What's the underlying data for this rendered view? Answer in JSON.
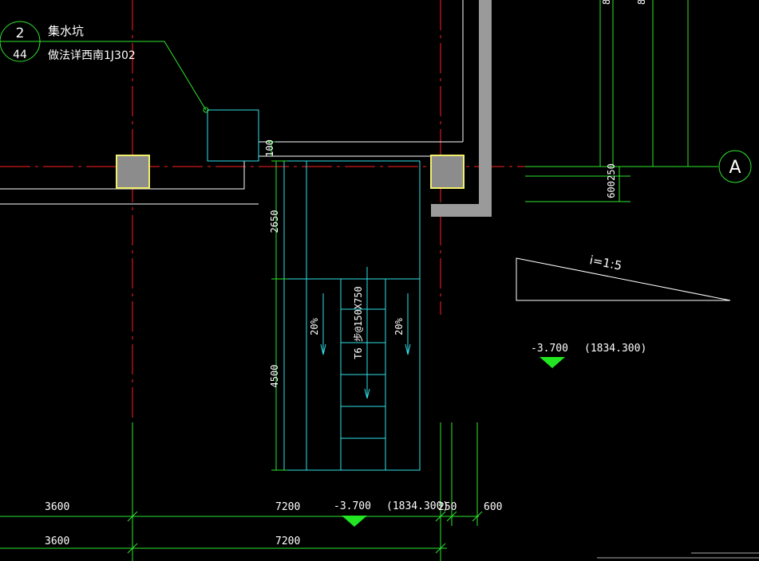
{
  "colors": {
    "background": "#000000",
    "axis": "#ff2020",
    "dimension": "#2ee62e",
    "wall": "#ffffff",
    "pit": "#2fdfe6",
    "column_fill": "#8c8c8c",
    "column_edge": "#f2f06a",
    "slab": "#9a9a9a",
    "text": "#ffffff",
    "level_marker": "#22e622"
  },
  "callout": {
    "ref_number": "2",
    "sheet_number": "44",
    "title": "集水坑",
    "note": "做法详西南1J302"
  },
  "axis_bubble": {
    "label": "A"
  },
  "dims": {
    "pit_gap": "100",
    "right_250": "250",
    "right_600": "600",
    "ramp_2650": "2650",
    "ramp_4500": "4500",
    "bottom_row1": [
      "3600",
      "7200",
      "250",
      "600"
    ],
    "bottom_row2": [
      "3600",
      "7200"
    ]
  },
  "ramp": {
    "left_slope": "20%",
    "right_slope": "20%",
    "steps_note": "Τ6 步@150X750"
  },
  "slope_note": "i=1:5",
  "levels": [
    {
      "value": "-3.700",
      "absolute": "(1834.300)"
    },
    {
      "value": "-3.700",
      "absolute": "(1834.300)"
    }
  ]
}
